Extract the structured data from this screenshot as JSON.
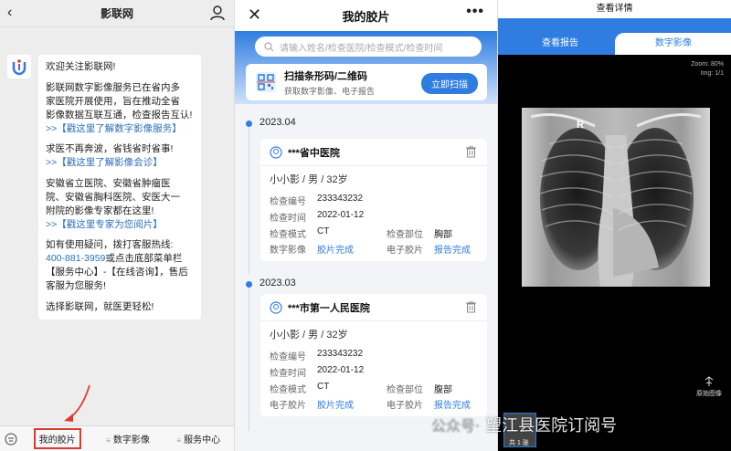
{
  "chat": {
    "back_icon": "chevron-left-icon",
    "title": "影联网",
    "user_icon": "user-icon",
    "paragraphs": [
      {
        "lines": [
          "欢迎关注影联网!"
        ]
      },
      {
        "lines": [
          "影联网数字影像服务已在省内多",
          "家医院开展使用，旨在推动全省",
          "影像数据互联互通，检查报告互认!"
        ],
        "link": ">>【戳这里了解数字影像服务】"
      },
      {
        "lines": [
          "求医不再奔波，省钱省时省事!"
        ],
        "link": ">>【戳这里了解影像会诊】"
      },
      {
        "lines": [
          "安徽省立医院、安徽省肿瘤医",
          "院、安徽省胸科医院、安医大一",
          "附院的影像专家都在这里!"
        ],
        "link": ">>【戳这里专家为您阅片】"
      },
      {
        "lines": [
          "如有使用疑问，拨打客服热线:"
        ],
        "phone": "400-881-3959",
        "after_phone": "或点击底部菜单栏【服务中心】-【在线咨询】，售后客服为您服务!"
      },
      {
        "lines": [
          "选择影联网，就医更轻松!"
        ]
      }
    ],
    "menu": [
      "我的胶片",
      "数字影像",
      "服务中心"
    ]
  },
  "films": {
    "title": "我的胶片",
    "more": "•••",
    "search_placeholder": "请输入姓名/检查医院/检查模式/检查时间",
    "scan_title": "扫描条形码/二维码",
    "scan_sub": "获取数字影像、电子报告",
    "scan_button": "立即扫描",
    "records": [
      {
        "date": "2023.04",
        "hospital": "***省中医院",
        "person": "小小影 / 男 / 32岁",
        "exam_no_label": "检查编号",
        "exam_no": "233343232",
        "exam_time_label": "检查时间",
        "exam_time": "2022-01-12",
        "mode_label": "检查模式",
        "mode": "CT",
        "part_label": "检查部位",
        "part": "胸部",
        "digital_label": "数字影像",
        "digital": "胶片完成",
        "efilm_label": "电子胶片",
        "efilm": "报告完成"
      },
      {
        "date": "2023.03",
        "hospital": "***市第一人民医院",
        "person": "小小影 / 男 / 32岁",
        "exam_no_label": "检查编号",
        "exam_no": "233343232",
        "exam_time_label": "检查时间",
        "exam_time": "2022-01-12",
        "mode_label": "检查模式",
        "mode": "CT",
        "part_label": "检查部位",
        "part": "腹部",
        "digital_label": "电子胶片",
        "digital": "胶片完成",
        "efilm_label": "电子胶片",
        "efilm": "报告完成"
      }
    ]
  },
  "viewer": {
    "title": "查看详情",
    "tab_report": "查看报告",
    "tab_digital": "数字影像",
    "zoom": "Zoom: 80%",
    "img": "Img: 1/1",
    "marker": "R",
    "raw_label": "原始图像",
    "thumb_label": "共 1 张"
  },
  "watermark": "望江县医院订阅号",
  "watermark_prefix": "公众号·",
  "colors": {
    "accent": "#2f7de1",
    "highlight": "#e0392b"
  }
}
